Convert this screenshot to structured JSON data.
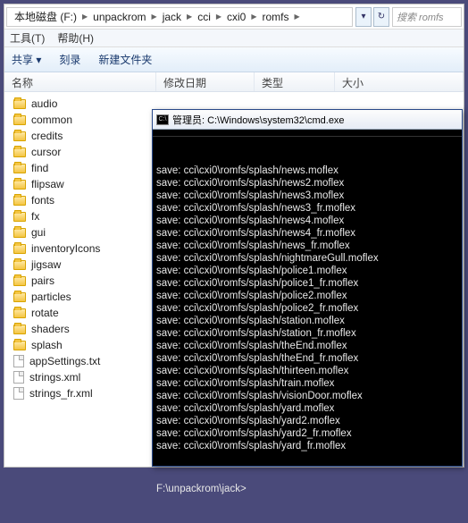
{
  "address": {
    "crumbs": [
      "本地磁盘 (F:)",
      "unpackrom",
      "jack",
      "cci",
      "cxi0",
      "romfs"
    ],
    "search_placeholder": "搜索 romfs"
  },
  "menubar": {
    "tools": "工具(T)",
    "help": "帮助(H)"
  },
  "toolbar": {
    "share": "共享 ▾",
    "burn": "刻录",
    "newfolder": "新建文件夹"
  },
  "columns": {
    "name": "名称",
    "modified": "修改日期",
    "type": "类型",
    "size": "大小"
  },
  "files": [
    {
      "name": "audio",
      "type": "folder"
    },
    {
      "name": "common",
      "type": "folder"
    },
    {
      "name": "credits",
      "type": "folder"
    },
    {
      "name": "cursor",
      "type": "folder"
    },
    {
      "name": "find",
      "type": "folder"
    },
    {
      "name": "flipsaw",
      "type": "folder"
    },
    {
      "name": "fonts",
      "type": "folder"
    },
    {
      "name": "fx",
      "type": "folder"
    },
    {
      "name": "gui",
      "type": "folder"
    },
    {
      "name": "inventoryIcons",
      "type": "folder"
    },
    {
      "name": "jigsaw",
      "type": "folder"
    },
    {
      "name": "pairs",
      "type": "folder"
    },
    {
      "name": "particles",
      "type": "folder"
    },
    {
      "name": "rotate",
      "type": "folder"
    },
    {
      "name": "shaders",
      "type": "folder"
    },
    {
      "name": "splash",
      "type": "folder"
    },
    {
      "name": "appSettings.txt",
      "type": "file"
    },
    {
      "name": "strings.xml",
      "type": "file"
    },
    {
      "name": "strings_fr.xml",
      "type": "file"
    }
  ],
  "cmd": {
    "title": "管理员: C:\\Windows\\system32\\cmd.exe",
    "lines": [
      "save: cci\\cxi0\\romfs/splash/news.moflex",
      "save: cci\\cxi0\\romfs/splash/news2.moflex",
      "save: cci\\cxi0\\romfs/splash/news3.moflex",
      "save: cci\\cxi0\\romfs/splash/news3_fr.moflex",
      "save: cci\\cxi0\\romfs/splash/news4.moflex",
      "save: cci\\cxi0\\romfs/splash/news4_fr.moflex",
      "save: cci\\cxi0\\romfs/splash/news_fr.moflex",
      "save: cci\\cxi0\\romfs/splash/nightmareGull.moflex",
      "save: cci\\cxi0\\romfs/splash/police1.moflex",
      "save: cci\\cxi0\\romfs/splash/police1_fr.moflex",
      "save: cci\\cxi0\\romfs/splash/police2.moflex",
      "save: cci\\cxi0\\romfs/splash/police2_fr.moflex",
      "save: cci\\cxi0\\romfs/splash/station.moflex",
      "save: cci\\cxi0\\romfs/splash/station_fr.moflex",
      "save: cci\\cxi0\\romfs/splash/theEnd.moflex",
      "save: cci\\cxi0\\romfs/splash/theEnd_fr.moflex",
      "save: cci\\cxi0\\romfs/splash/thirteen.moflex",
      "save: cci\\cxi0\\romfs/splash/train.moflex",
      "save: cci\\cxi0\\romfs/splash/visionDoor.moflex",
      "save: cci\\cxi0\\romfs/splash/yard.moflex",
      "save: cci\\cxi0\\romfs/splash/yard2.moflex",
      "save: cci\\cxi0\\romfs/splash/yard2_fr.moflex",
      "save: cci\\cxi0\\romfs/splash/yard_fr.moflex"
    ],
    "prompt": "F:\\unpackrom\\jack>"
  }
}
